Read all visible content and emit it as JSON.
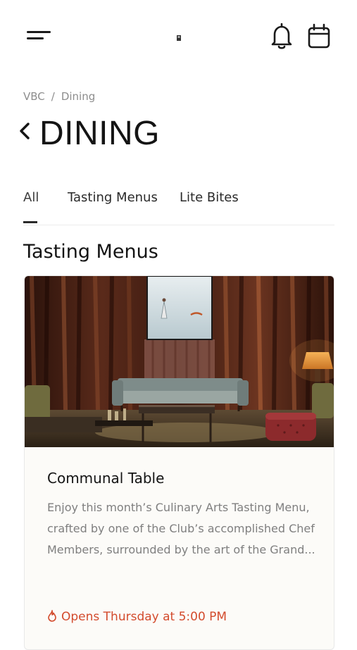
{
  "header": {
    "menu_icon": "hamburger-menu-icon",
    "logo_icon": "club-logo-icon",
    "bell_icon": "notification-bell-icon",
    "calendar_icon": "calendar-icon"
  },
  "breadcrumb": {
    "root": "VBC",
    "separator": "/",
    "current": "Dining"
  },
  "page": {
    "back_icon": "chevron-left-icon",
    "title": "DINING"
  },
  "tabs": [
    {
      "label": "All",
      "active": true
    },
    {
      "label": "Tasting Menus",
      "active": false
    },
    {
      "label": "Lite Bites",
      "active": false
    }
  ],
  "section": {
    "title": "Tasting Menus"
  },
  "card": {
    "title": "Communal Table",
    "description_lines": [
      "Enjoy this month’s Culinary Arts Tasting Menu,",
      "crafted by one of the Club’s accomplished Chef",
      "Members, surrounded by the art of the Grand..."
    ],
    "status_icon": "flame-icon",
    "status": "Opens Thursday at 5:00 PM"
  },
  "colors": {
    "text_primary": "#141414",
    "text_muted": "#8d8d8d",
    "accent_status": "#d34b2d",
    "card_background": "#fcfbf8"
  }
}
